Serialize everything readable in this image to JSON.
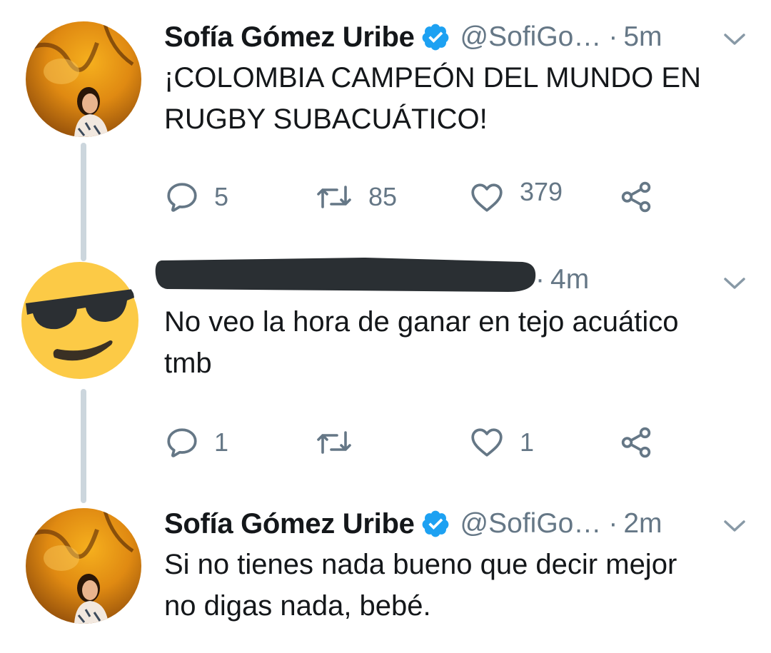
{
  "tweets": [
    {
      "author_name": "Sofía Gómez Uribe",
      "handle": "@SofiGo…",
      "separator": "·",
      "time": "5m",
      "text_lines": [
        "¡COLOMBIA CAMPEÓN DEL MUNDO EN",
        "RUGBY SUBACUÁTICO!"
      ],
      "replies": "5",
      "retweets": "85",
      "likes": "379"
    },
    {
      "author_name": "",
      "separator": "·",
      "time": "4m",
      "text_lines": [
        "No veo la hora de ganar en tejo acuático",
        "tmb"
      ],
      "replies": "1",
      "retweets": "",
      "likes": "1"
    },
    {
      "author_name": "Sofía Gómez Uribe",
      "handle": "@SofiGo…",
      "separator": "·",
      "time": "2m",
      "text_lines": [
        "Si no tienes nada bueno que decir mejor",
        "no digas nada, bebé."
      ]
    }
  ],
  "icons": {
    "reply": "reply-icon",
    "retweet": "retweet-icon",
    "like": "heart-icon",
    "share": "share-icon",
    "verified": "verified-badge-icon",
    "menu": "chevron-down-icon"
  },
  "colors": {
    "text_primary": "#14171a",
    "text_secondary": "#657786",
    "verified_blue": "#1da1f2",
    "thread_line": "#ccd6dd",
    "redaction": "#2a2f33",
    "emoji_yellow": "#fcca46"
  }
}
